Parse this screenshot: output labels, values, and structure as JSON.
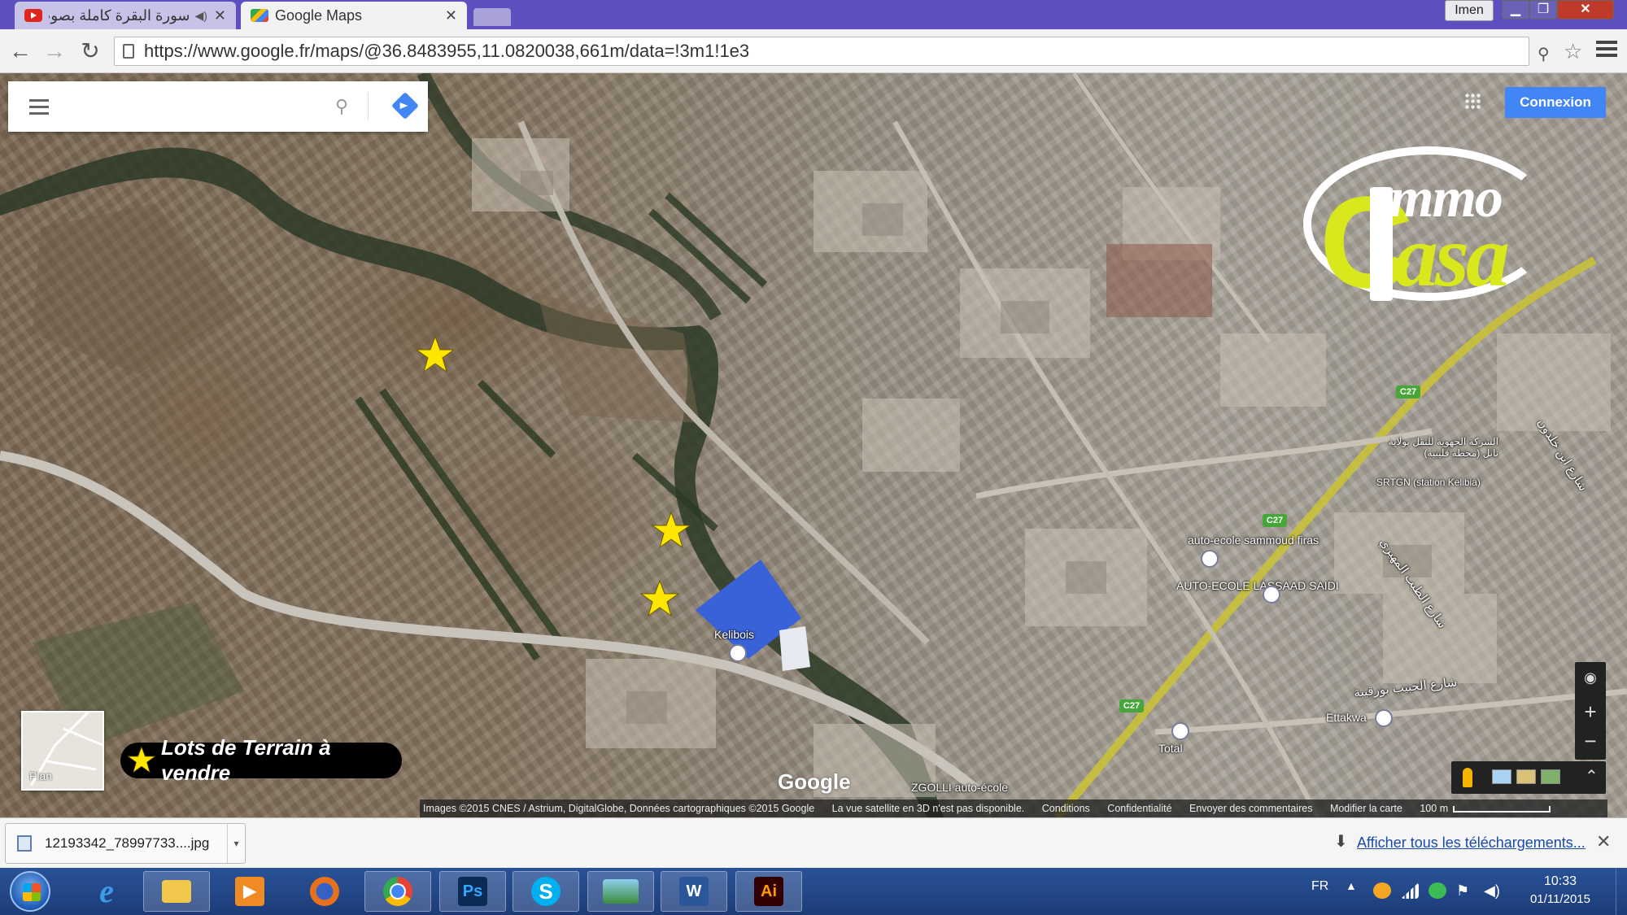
{
  "browser": {
    "tabs": [
      {
        "title": "سورة البقرة كاملة بصوت القار",
        "favicon": "youtube-icon",
        "active": false
      },
      {
        "title": "Google Maps",
        "favicon": "google-maps-icon",
        "active": true
      }
    ],
    "user_name": "Imen",
    "url": "https://www.google.fr/maps/@36.8483955,11.0820038,661m/data=!3m1!1e3"
  },
  "map": {
    "search_placeholder": "",
    "signin_label": "Connexion",
    "google_watermark": "Google",
    "plan_label": "Plan",
    "labels": {
      "kelibois": "Kelibois",
      "auto_ecole_sammoud": "auto-ecole sammoud firas",
      "auto_ecole_lassaad": "AUTO-ECOLE LASSAAD SAIDI",
      "ettakwa": "Ettakwa",
      "total": "Total",
      "zgolli": "ZGOLLI auto-école",
      "srtgn": "SRTGN (station Kelibia)",
      "arabic_company": "الشركة الجهوية للنقل بولاية نابل (محطة قليبية)",
      "arabic_street_1": "شارع ابن خلدون",
      "arabic_street_2": "شارع الحبيب بورقيبة",
      "arabic_street_3": "شارع الطيب المهيري"
    },
    "road_shields": [
      "C27",
      "C27",
      "C27"
    ],
    "attribution": {
      "images": "Images ©2015 CNES / Astrium, DigitalGlobe, Données cartographiques ©2015 Google",
      "no3d": "La vue satellite en 3D n'est pas disponible.",
      "terms": "Conditions",
      "privacy": "Confidentialité",
      "feedback": "Envoyer des commentaires",
      "edit": "Modifier la carte",
      "scale": "100 m"
    }
  },
  "overlay": {
    "logo_top": "mmo",
    "logo_bottom": "asa",
    "legend_text": "Lots de Terrain à vendre",
    "star_color": "#ffe600"
  },
  "downloads": {
    "file_name": "12193342_78997733....jpg",
    "show_all": "Afficher tous les téléchargements..."
  },
  "taskbar": {
    "apps": [
      "internet-explorer",
      "file-explorer",
      "media-player",
      "firefox",
      "chrome",
      "photoshop",
      "skype",
      "photo-viewer",
      "word",
      "illustrator"
    ],
    "language": "FR",
    "time": "10:33",
    "date": "01/11/2015"
  }
}
